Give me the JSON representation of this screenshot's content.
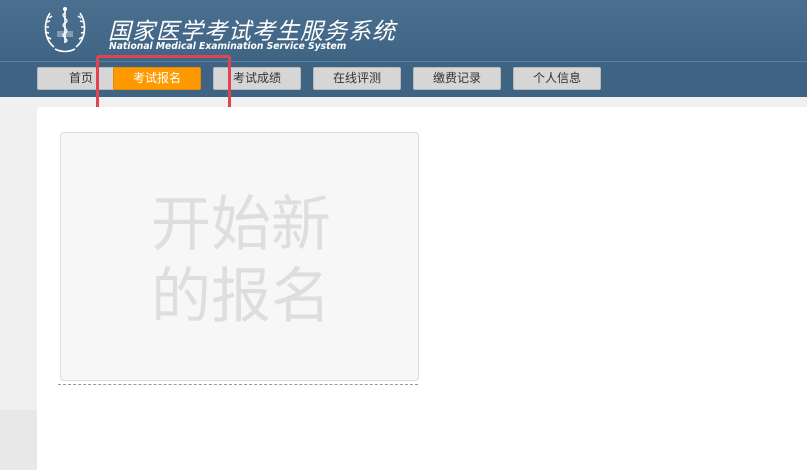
{
  "header": {
    "title_cn": "国家医学考试考生服务系统",
    "title_en": "National Medical Examination Service System",
    "logo_icon": "caduceus-emblem-icon"
  },
  "nav": {
    "items": [
      {
        "label": "首页"
      },
      {
        "label": "考试报名",
        "active": true
      },
      {
        "label": "考试成绩"
      },
      {
        "label": "在线评测"
      },
      {
        "label": "缴费记录"
      },
      {
        "label": "个人信息"
      }
    ]
  },
  "main": {
    "new_registration_label": "开始新的报名"
  },
  "colors": {
    "header_bg": "#46698a",
    "active_tab": "#ff9900",
    "highlight": "#e0454f"
  }
}
